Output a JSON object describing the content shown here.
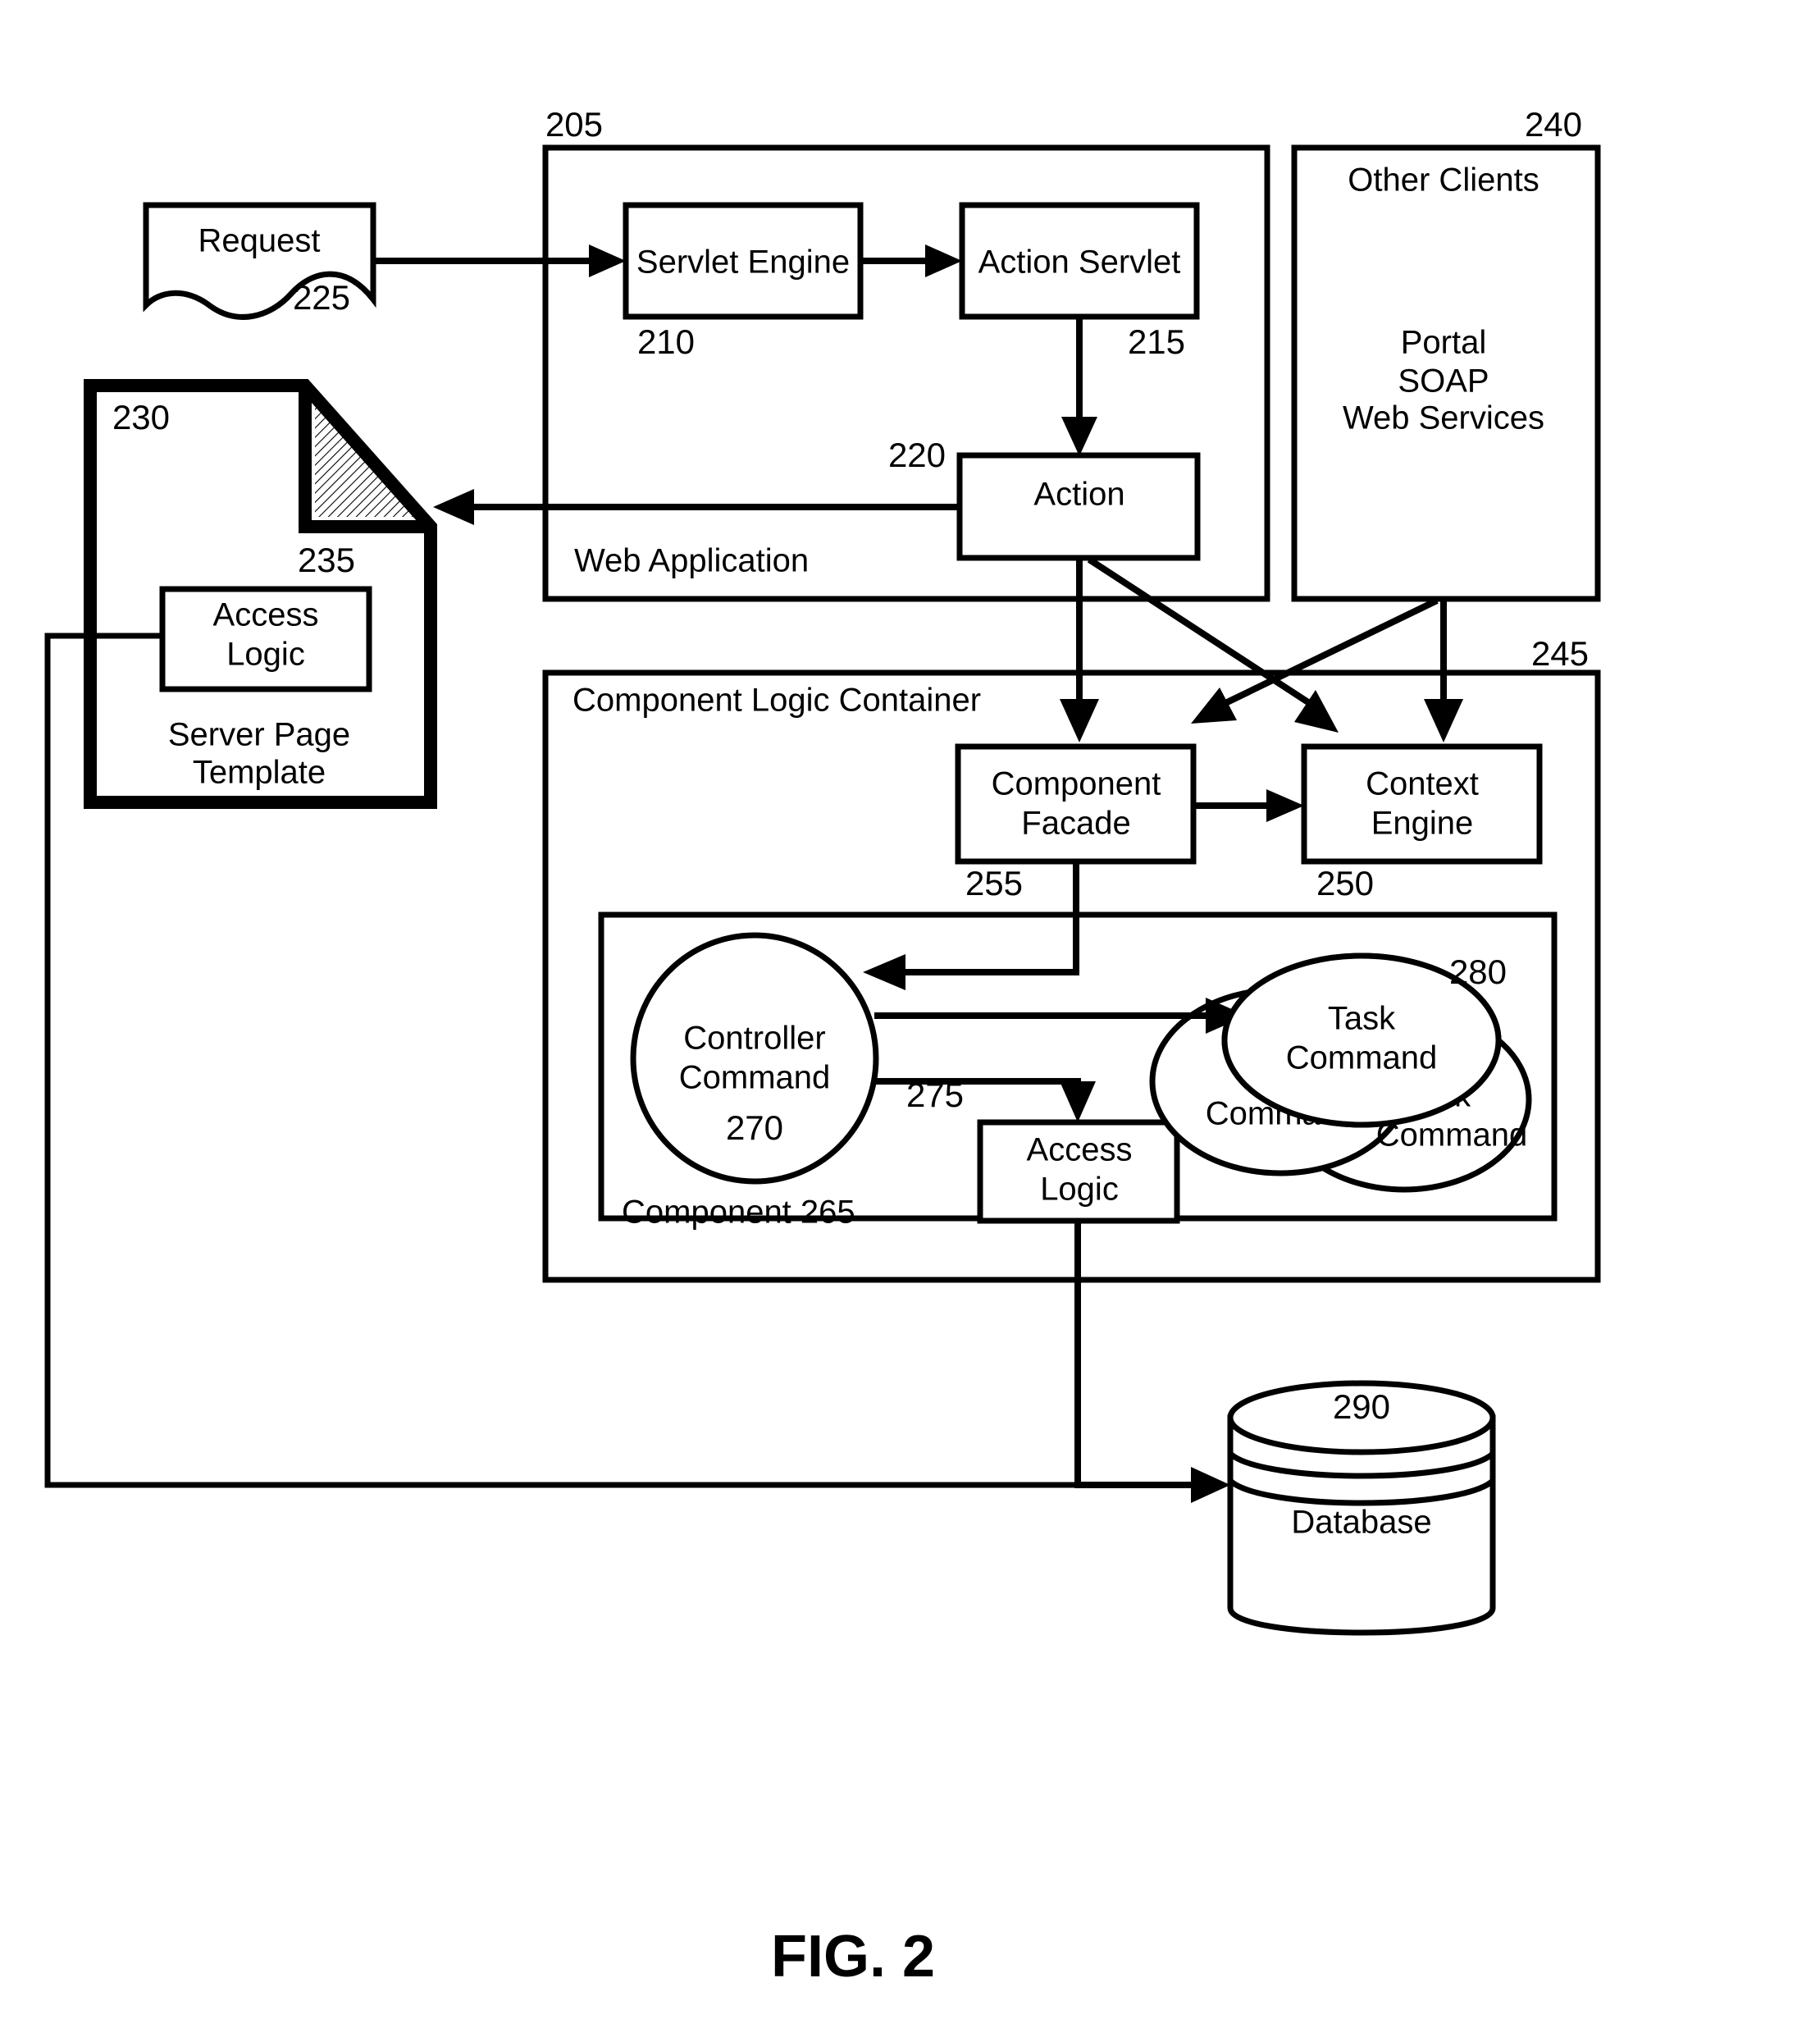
{
  "figure": {
    "caption": "FIG. 2"
  },
  "nodes": {
    "request": {
      "label": "Request",
      "ref": "225"
    },
    "web_application": {
      "label": "Web Application",
      "ref": "205"
    },
    "servlet_engine": {
      "label": "Servlet Engine",
      "ref": "210"
    },
    "action_servlet": {
      "label": "Action Servlet",
      "ref": "215"
    },
    "action": {
      "label": "Action",
      "ref": "220"
    },
    "other_clients": {
      "label": "Other Clients",
      "ref": "240",
      "line1": "Portal",
      "line2": "SOAP",
      "line3": "Web Services"
    },
    "server_page_template": {
      "ref": "230",
      "line1": "Server Page",
      "line2": "Template"
    },
    "server_page_access_logic": {
      "line1": "Access",
      "line2": "Logic",
      "ref": "235"
    },
    "component_logic_container": {
      "label": "Component Logic Container",
      "ref": "245"
    },
    "component_facade": {
      "line1": "Component",
      "line2": "Facade",
      "ref": "255"
    },
    "context_engine": {
      "line1": "Context",
      "line2": "Engine",
      "ref": "250"
    },
    "component": {
      "label": "Component 265"
    },
    "controller_command": {
      "line1": "Controller",
      "line2": "Command",
      "ref": "270"
    },
    "component_access_logic": {
      "line1": "Access",
      "line2": "Logic",
      "ref": "275"
    },
    "task_command_front": {
      "line1": "Task",
      "line2": "Command",
      "ref": "280"
    },
    "task_command_mid": {
      "line1": "Task",
      "line2": "Command"
    },
    "task_command_back": {
      "line1": "Task",
      "line2": "Command"
    },
    "database": {
      "label": "Database",
      "ref": "290"
    }
  }
}
